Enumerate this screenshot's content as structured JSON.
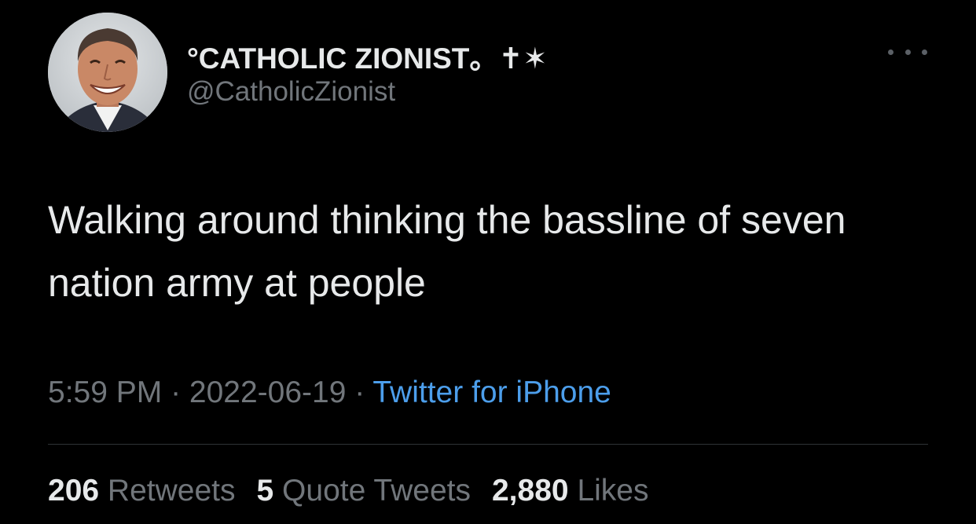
{
  "author": {
    "display_name": "°CATHOLIC ZIONIST。✝✶",
    "handle": "@CatholicZionist"
  },
  "tweet": {
    "text": "Walking around thinking the bassline of seven nation army at people"
  },
  "meta": {
    "time": "5:59 PM",
    "separator": " · ",
    "date": "2022-06-19",
    "source": "Twitter for iPhone"
  },
  "stats": {
    "retweets_count": "206",
    "retweets_label": "Retweets",
    "quotes_count": "5",
    "quotes_label": "Quote Tweets",
    "likes_count": "2,880",
    "likes_label": "Likes"
  },
  "icons": {
    "more": "more-horizontal-icon"
  },
  "colors": {
    "background": "#000000",
    "text_primary": "#e7e9ea",
    "text_secondary": "#71767b",
    "link": "#4c9eeb",
    "divider": "#2f3336"
  }
}
